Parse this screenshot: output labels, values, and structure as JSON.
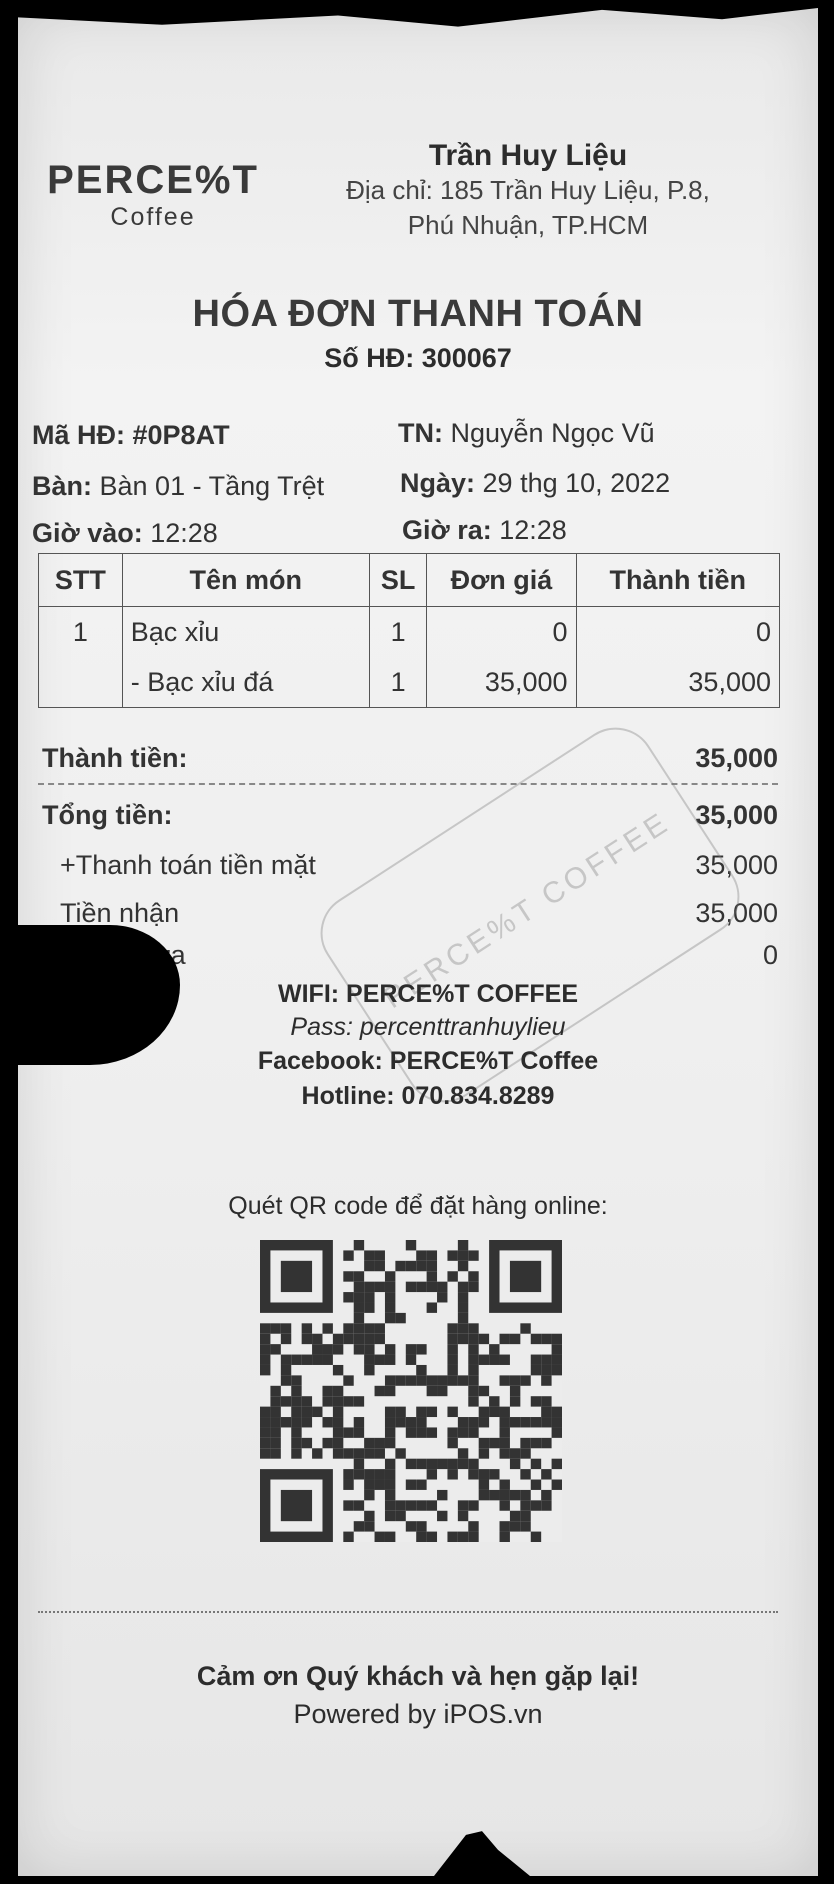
{
  "brand": {
    "name": "PERCE%T",
    "sub": "Coffee"
  },
  "store": {
    "name": "Trần Huy Liệu",
    "address_line1": "Địa chỉ: 185 Trần Huy Liệu, P.8,",
    "address_line2": "Phú Nhuận, TP.HCM"
  },
  "invoice": {
    "title": "HÓA ĐƠN THANH TOÁN",
    "number": "Số HĐ: 300067",
    "code_label": "Mã HĐ:",
    "code": "#0P8AT",
    "cashier_label": "TN:",
    "cashier": "Nguyễn Ngọc Vũ",
    "table_label": "Bàn:",
    "table": "Bàn 01 - Tầng Trệt",
    "date_label": "Ngày:",
    "date": "29 thg 10, 2022",
    "time_in_label": "Giờ vào:",
    "time_in": "12:28",
    "time_out_label": "Giờ ra:",
    "time_out": "12:28"
  },
  "table": {
    "headers": [
      "STT",
      "Tên món",
      "SL",
      "Đơn giá",
      "Thành tiền"
    ],
    "rows": [
      {
        "stt": "1",
        "name": "Bạc xỉu",
        "qty": "1",
        "price": "0",
        "total": "0"
      },
      {
        "stt": "",
        "name": "- Bạc xỉu đá",
        "qty": "1",
        "price": "35,000",
        "total": "35,000"
      }
    ]
  },
  "summary": {
    "subtotal_label": "Thành tiền:",
    "subtotal": "35,000",
    "grand_label": "Tổng tiền:",
    "grand": "35,000",
    "cash_label": "+Thanh toán tiền mặt",
    "cash": "35,000",
    "received_label": "Tiền nhận",
    "received": "35,000",
    "change_label": "thừa",
    "change": "0"
  },
  "footer": {
    "wifi": "WIFI: PERCE%T COFFEE",
    "pass": "Pass: percenttranhuylieu",
    "facebook": "Facebook: PERCE%T Coffee",
    "hotline": "Hotline: 070.834.8289",
    "qr_prompt": "Quét QR code để đặt hàng online:",
    "thanks": "Cảm ơn Quý khách và hẹn gặp lại!",
    "powered": "Powered by iPOS.vn"
  },
  "stamp_text": "PERCE%T COFFEE"
}
